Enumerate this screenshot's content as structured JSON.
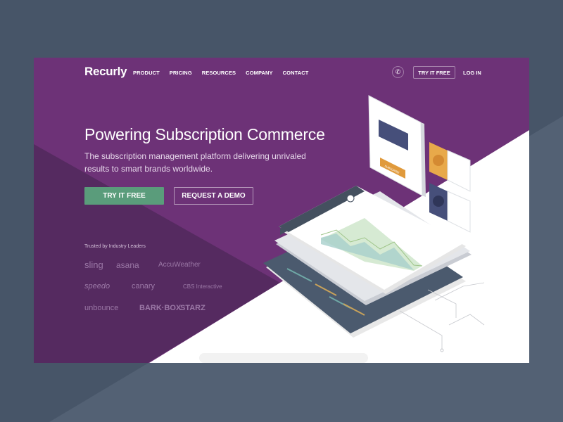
{
  "colors": {
    "page_bg_dark": "#475568",
    "page_bg_light": "#536174",
    "purple": "#6d3277",
    "purple_dark": "#552a60",
    "green": "#5a9c7b",
    "orange": "#e09a3c",
    "slate": "#46566a"
  },
  "nav": {
    "logo": "Recurly",
    "links": [
      "PRODUCT",
      "PRICING",
      "RESOURCES",
      "COMPANY",
      "CONTACT"
    ],
    "phone_icon": "phone-icon",
    "try_label": "TRY IT FREE",
    "login_label": "LOG IN"
  },
  "hero": {
    "title": "Powering Subscription Commerce",
    "subtitle": "The subscription management platform delivering unrivaled results to smart brands worldwide.",
    "primary_cta": "TRY IT FREE",
    "secondary_cta": "REQUEST A DEMO"
  },
  "trusted": {
    "heading": "Trusted by Industry Leaders",
    "logos": [
      "sling",
      "asana",
      "AccuWeather",
      "speedo",
      "canary",
      "CBS Interactive",
      "unbounce",
      "BARK·BOX",
      "STARZ"
    ]
  },
  "illustration": {
    "subscribe_label": "SUBSCRIBE"
  }
}
